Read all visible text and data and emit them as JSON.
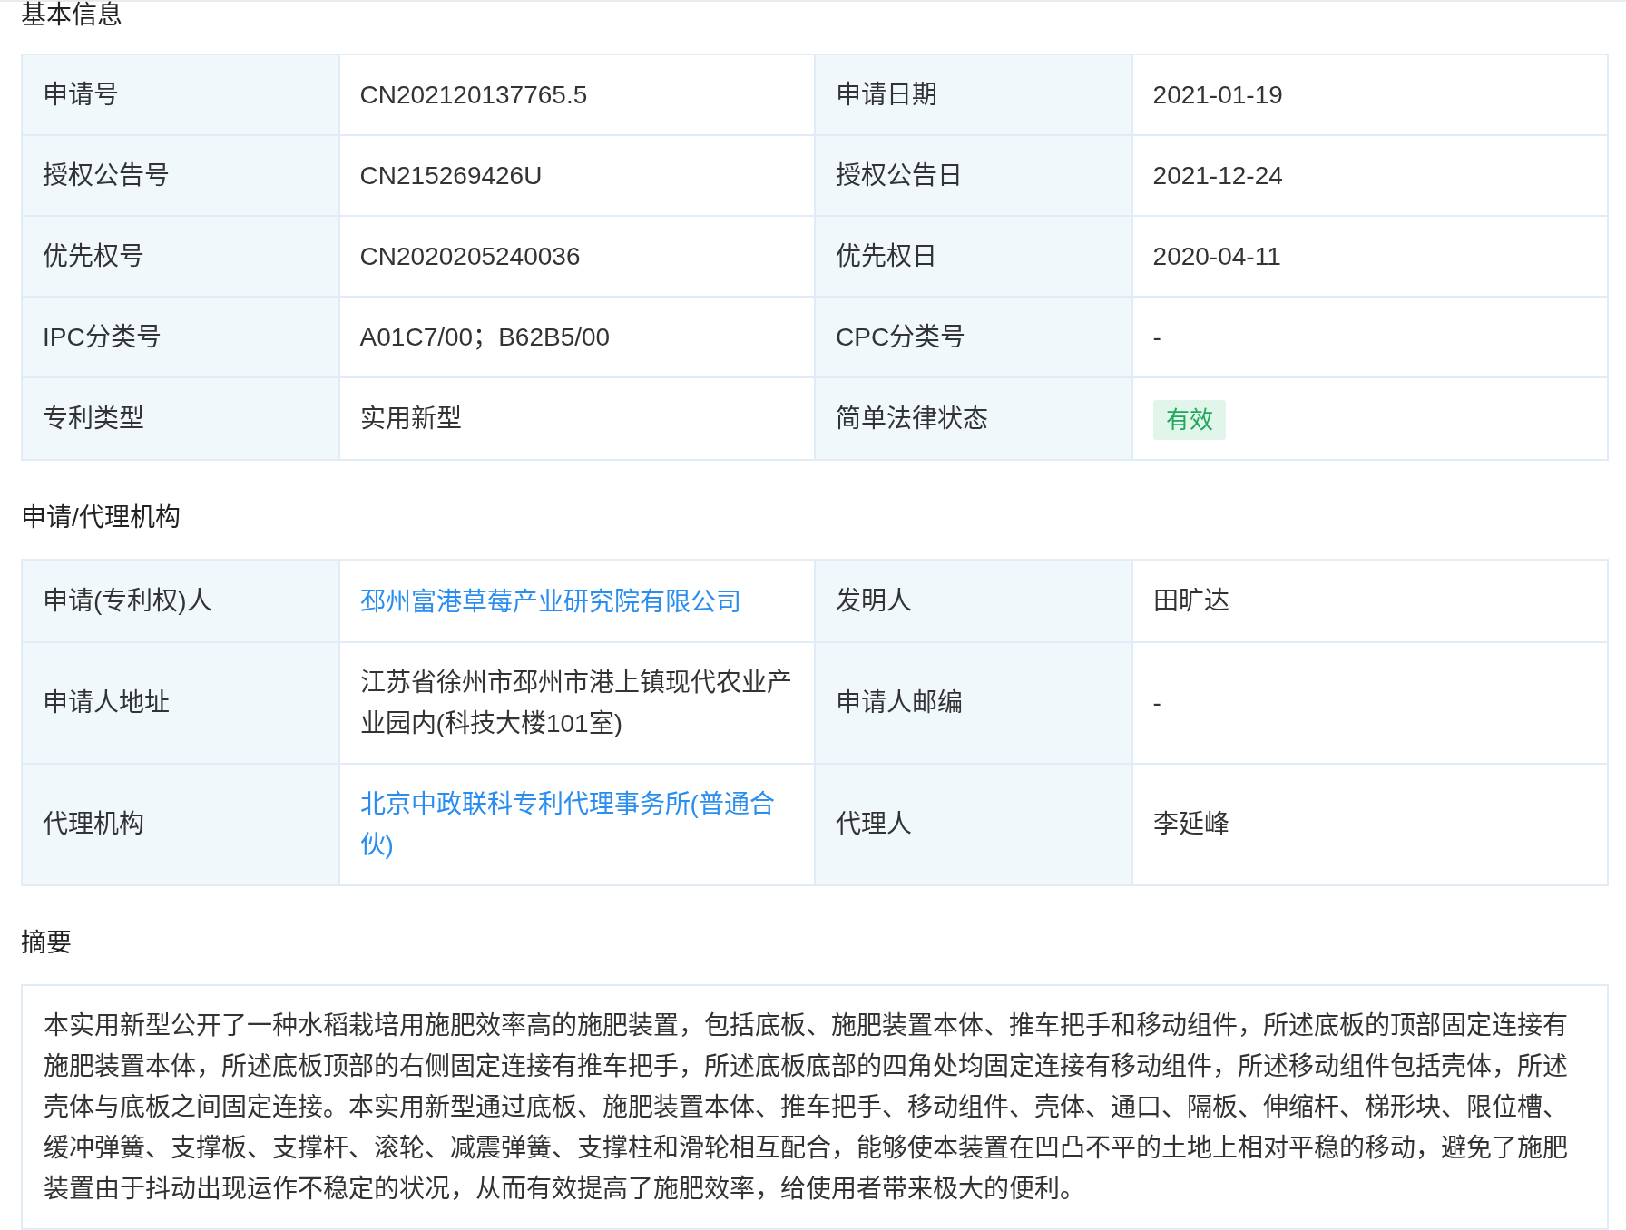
{
  "sections": [
    {
      "title": "基本信息",
      "kind": "table",
      "rows": [
        [
          {
            "label": "申请号",
            "value": "CN202120137765.5",
            "kind": "text"
          },
          {
            "label": "申请日期",
            "value": "2021-01-19",
            "kind": "text"
          }
        ],
        [
          {
            "label": "授权公告号",
            "value": "CN215269426U",
            "kind": "text"
          },
          {
            "label": "授权公告日",
            "value": "2021-12-24",
            "kind": "text"
          }
        ],
        [
          {
            "label": "优先权号",
            "value": "CN2020205240036",
            "kind": "text"
          },
          {
            "label": "优先权日",
            "value": "2020-04-11",
            "kind": "text"
          }
        ],
        [
          {
            "label": "IPC分类号",
            "value": "A01C7/00；B62B5/00",
            "kind": "text"
          },
          {
            "label": "CPC分类号",
            "value": "-",
            "kind": "text"
          }
        ],
        [
          {
            "label": "专利类型",
            "value": "实用新型",
            "kind": "text"
          },
          {
            "label": "简单法律状态",
            "value": "有效",
            "kind": "badge"
          }
        ]
      ]
    },
    {
      "title": "申请/代理机构",
      "kind": "table",
      "rows": [
        [
          {
            "label": "申请(专利权)人",
            "value": "邳州富港草莓产业研究院有限公司",
            "kind": "link"
          },
          {
            "label": "发明人",
            "value": "田旷达",
            "kind": "text"
          }
        ],
        [
          {
            "label": "申请人地址",
            "value": "江苏省徐州市邳州市港上镇现代农业产业园内(科技大楼101室)",
            "kind": "text"
          },
          {
            "label": "申请人邮编",
            "value": "-",
            "kind": "text"
          }
        ],
        [
          {
            "label": "代理机构",
            "value": "北京中政联科专利代理事务所(普通合伙)",
            "kind": "link"
          },
          {
            "label": "代理人",
            "value": "李延峰",
            "kind": "text"
          }
        ]
      ]
    },
    {
      "title": "摘要",
      "kind": "text",
      "text": "本实用新型公开了一种水稻栽培用施肥效率高的施肥装置，包括底板、施肥装置本体、推车把手和移动组件，所述底板的顶部固定连接有施肥装置本体，所述底板顶部的右侧固定连接有推车把手，所述底板底部的四角处均固定连接有移动组件，所述移动组件包括壳体，所述壳体与底板之间固定连接。本实用新型通过底板、施肥装置本体、推车把手、移动组件、壳体、通口、隔板、伸缩杆、梯形块、限位槽、缓冲弹簧、支撑板、支撑杆、滚轮、减震弹簧、支撑柱和滑轮相互配合，能够使本装置在凹凸不平的土地上相对平稳的移动，避免了施肥装置由于抖动出现运作不稳定的状况，从而有效提高了施肥效率，给使用者带来极大的便利。"
    }
  ]
}
